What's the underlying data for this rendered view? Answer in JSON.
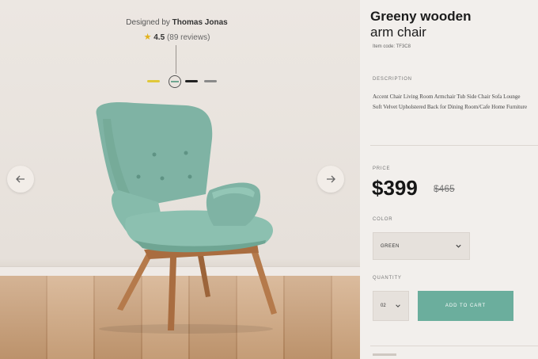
{
  "product_stage": {
    "designer_prefix": "Designed by",
    "designer_name": "Thomas Jonas",
    "rating_score": "4.5",
    "rating_reviews": "(89 reviews)",
    "swatches": [
      {
        "name": "yellow",
        "color": "#e1c83a"
      },
      {
        "name": "green",
        "color": "#6fa591",
        "selected": true
      },
      {
        "name": "black",
        "color": "#222222"
      },
      {
        "name": "gray",
        "color": "#8a8a8a"
      }
    ],
    "prev_icon": "arrow-left-icon",
    "next_icon": "arrow-right-icon"
  },
  "detail": {
    "title_line1": "Greeny wooden",
    "title_line2": "arm chair",
    "item_code": "Item code: TF3C8",
    "description_label": "DESCRIPTION",
    "description": "Accent Chair Living Room Armchair Tub Side Chair Sofa Lounge Soft Velvet Upholstered Back for Dining Room/Cafe Home Furniture",
    "price_label": "PRICE",
    "price": "$399",
    "old_price": "$465",
    "color_label": "COLOR",
    "color_value": "GREEN",
    "quantity_label": "QUANTITY",
    "quantity_value": "02",
    "add_to_cart": "ADD TO CART"
  },
  "colors": {
    "accent": "#6bae9d",
    "chair": "#7fb3a4",
    "wood": "#b57a4b",
    "star": "#e2b21b"
  }
}
